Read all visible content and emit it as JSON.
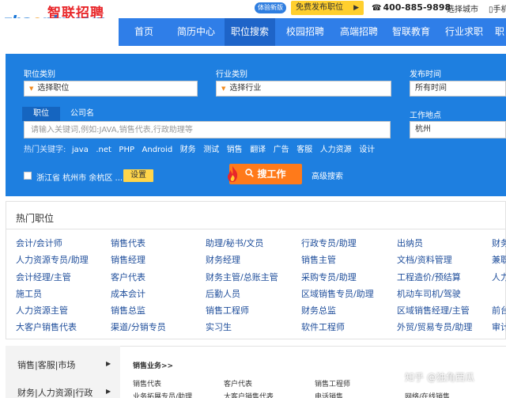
{
  "header": {
    "logo_cn": "智联招聘",
    "logo_en_a": "zha",
    "logo_en_b": "o",
    "logo_en_c": "pin.com",
    "experience_badge": "体验新版",
    "post_job": "免费发布职位",
    "post_job_arrow": "▶",
    "phone_icon": "☎",
    "phone": "400-885-9898",
    "city": "选择城市",
    "mobile": "▯手机"
  },
  "nav": {
    "items": [
      "首页",
      "简历中心",
      "职位搜索",
      "校园招聘",
      "高端招聘",
      "智联教育",
      "行业求职",
      "职"
    ],
    "active_index": 2
  },
  "search": {
    "job_category_label": "职位类别",
    "job_category_value": "选择职位",
    "industry_label": "行业类别",
    "industry_value": "选择行业",
    "publish_time_label": "发布时间",
    "publish_time_value": "所有时间",
    "tab_job": "职位",
    "tab_company": "公司名",
    "keyword_placeholder": "请输入关键词,例如:JAVA,销售代表,行政助理等",
    "location_label": "工作地点",
    "location_value": "杭州",
    "hotkeys_label": "热门关键字:",
    "hotkeys": [
      "java",
      ".net",
      "PHP",
      "Android",
      "财务",
      "测试",
      "销售",
      "翻译",
      "广告",
      "客服",
      "人力资源",
      "设计"
    ],
    "location_filter": "浙江省 杭州市 余杭区 ...",
    "settings": "设置",
    "search_button": "搜工作",
    "advanced": "高级搜索"
  },
  "hot_jobs": {
    "title": "热门职位",
    "columns": [
      [
        "会计/会计师",
        "人力资源专员/助理",
        "会计经理/主管",
        "施工员",
        "人力资源主管",
        "大客户销售代表"
      ],
      [
        "销售代表",
        "销售经理",
        "客户代表",
        "成本会计",
        "销售总监",
        "渠道/分销专员"
      ],
      [
        "助理/秘书/文员",
        "财务经理",
        "财务主管/总账主管",
        "后勤人员",
        "销售工程师",
        "实习生"
      ],
      [
        "行政专员/助理",
        "销售主管",
        "采购专员/助理",
        "区域销售专员/助理",
        "财务总监",
        "软件工程师"
      ],
      [
        "出纳员",
        "文档/资料管理",
        "工程造价/预结算",
        "机动车司机/驾驶",
        "区域销售经理/主管",
        "外贸/贸易专员/助理"
      ],
      [
        "财务",
        "兼职",
        "人力",
        "",
        "前台",
        "审计"
      ]
    ]
  },
  "categories": {
    "items": [
      "销售|客服|市场",
      "财务|人力资源|行政"
    ],
    "heading": "销售业务>>",
    "subitems": [
      "销售代表",
      "客户代表",
      "销售工程师",
      "业务拓展专员/助理",
      "大客户销售代表",
      "电话销售",
      "网络/在线销售"
    ]
  },
  "watermark": "知乎 @独角西瓜"
}
